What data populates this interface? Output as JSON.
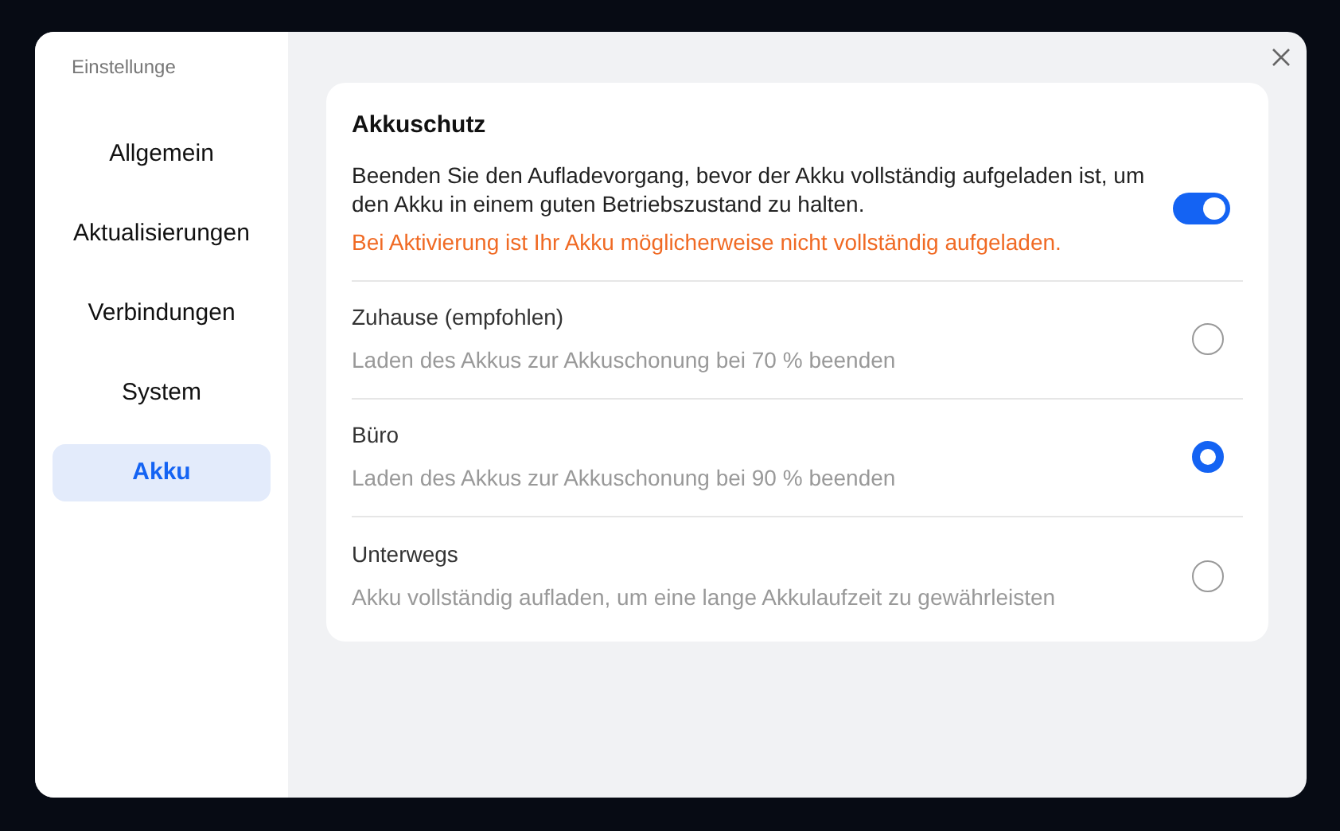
{
  "window": {
    "title": "Einstellunge"
  },
  "sidebar": {
    "items": [
      {
        "label": "Allgemein",
        "selected": false
      },
      {
        "label": "Aktualisierungen",
        "selected": false
      },
      {
        "label": "Verbindungen",
        "selected": false
      },
      {
        "label": "System",
        "selected": false
      },
      {
        "label": "Akku",
        "selected": true
      }
    ]
  },
  "section": {
    "title": "Akkuschutz",
    "description": "Beenden Sie den Aufladevorgang, bevor der Akku vollständig aufgeladen ist, um den Akku in einem guten Betriebszustand zu halten.",
    "warning": "Bei Aktivierung ist Ihr Akku möglicherweise nicht vollständig aufgeladen.",
    "on": true
  },
  "options": [
    {
      "label": "Zuhause (empfohlen)",
      "description": "Laden des Akkus zur Akkuschonung bei 70 % beenden",
      "selected": false
    },
    {
      "label": "Büro",
      "description": "Laden des Akkus zur Akkuschonung bei 90 % beenden",
      "selected": true
    },
    {
      "label": "Unterwegs",
      "description": "Akku vollständig aufladen, um eine lange Akkulaufzeit zu gewährleisten",
      "selected": false
    }
  ]
}
